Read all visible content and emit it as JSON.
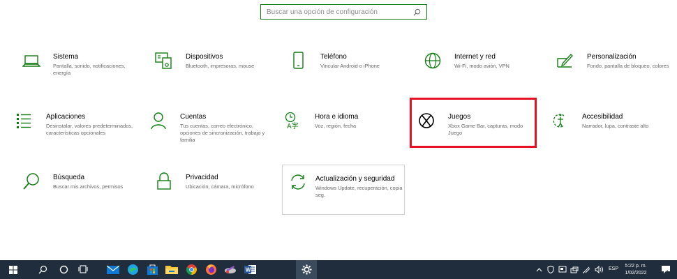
{
  "search": {
    "placeholder": "Buscar una opción de configuración"
  },
  "accent": "#107c10",
  "highlight_color": "#e81123",
  "tiles": [
    {
      "title": "Sistema",
      "desc": "Pantalla, sonido, notificaciones, energía",
      "icon": "laptop-icon"
    },
    {
      "title": "Dispositivos",
      "desc": "Bluetooth, impresoras, mouse",
      "icon": "keyboard-icon"
    },
    {
      "title": "Teléfono",
      "desc": "Vincular Android o iPhone",
      "icon": "phone-icon"
    },
    {
      "title": "Internet y red",
      "desc": "Wi-Fi, modo avión, VPN",
      "icon": "globe-icon"
    },
    {
      "title": "Personalización",
      "desc": "Fondo, pantalla de bloqueo, colores",
      "icon": "paint-icon"
    },
    {
      "title": "Aplicaciones",
      "desc": "Desinstalar, valores predeterminados, características opcionales",
      "icon": "apps-list-icon"
    },
    {
      "title": "Cuentas",
      "desc": "Tus cuentas, correo electrónico, opciones de sincronización, trabajo y familia",
      "icon": "person-icon"
    },
    {
      "title": "Hora e idioma",
      "desc": "Voz, región, fecha",
      "icon": "time-language-icon"
    },
    {
      "title": "Juegos",
      "desc": "Xbox Game Bar, capturas, modo Juego",
      "icon": "xbox-icon"
    },
    {
      "title": "Accesibilidad",
      "desc": "Narrador, lupa, contraste alto",
      "icon": "accessibility-icon"
    },
    {
      "title": "Búsqueda",
      "desc": "Buscar mis archivos, permisos",
      "icon": "search-icon"
    },
    {
      "title": "Privacidad",
      "desc": "Ubicación, cámara, micrófono",
      "icon": "lock-icon"
    },
    {
      "title": "Actualización y seguridad",
      "desc": "Windows Update, recuperación, copia seg.",
      "icon": "sync-icon"
    }
  ],
  "taskbar": {
    "lang": "ESP",
    "time": "5:22 p. m.",
    "date": "1/02/2022"
  }
}
